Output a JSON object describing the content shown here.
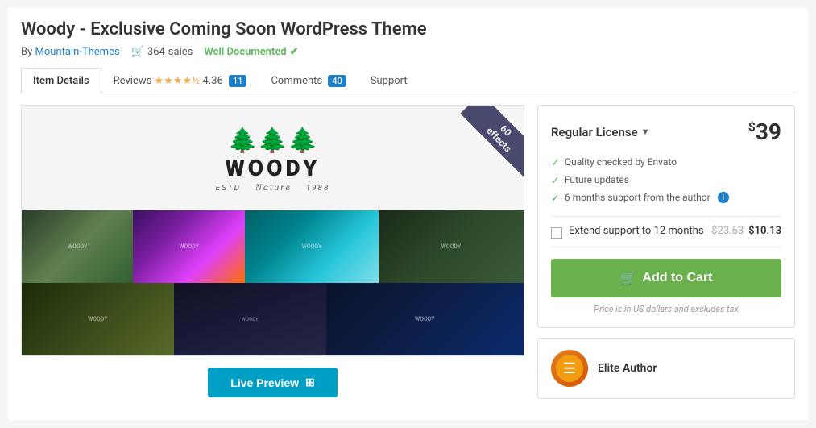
{
  "page": {
    "title": "Woody - Exclusive Coming Soon WordPress Theme",
    "author": {
      "by_label": "By",
      "name": "Mountain-Themes",
      "sales_count": "364",
      "sales_label": "sales",
      "well_documented": "Well Documented"
    }
  },
  "tabs": [
    {
      "id": "item-details",
      "label": "Item Details",
      "active": true
    },
    {
      "id": "reviews",
      "label": "Reviews",
      "stars": "★★★★½",
      "rating": "4.36"
    },
    {
      "id": "comments",
      "label": "Comments",
      "badge": "40"
    },
    {
      "id": "support",
      "label": "Support"
    }
  ],
  "preview": {
    "ribbon_text": "60 effects",
    "brand_name": "WOODY",
    "brand_estd": "ESTD",
    "brand_script": "Nature",
    "brand_year": "1988",
    "live_preview_label": "Live Preview"
  },
  "purchase": {
    "license_label": "Regular License",
    "price_symbol": "$",
    "price": "39",
    "features": [
      {
        "text": "Quality checked by Envato"
      },
      {
        "text": "Future updates"
      },
      {
        "text": "6 months support from the author",
        "has_info": true
      }
    ],
    "extend_label": "Extend support to 12 months",
    "extend_original_price": "$23.63",
    "extend_discount_price": "$10.13",
    "add_to_cart_label": "Add to Cart",
    "tax_note": "Price is in US dollars and excludes tax"
  },
  "author": {
    "badge_label": "Elite Author"
  }
}
